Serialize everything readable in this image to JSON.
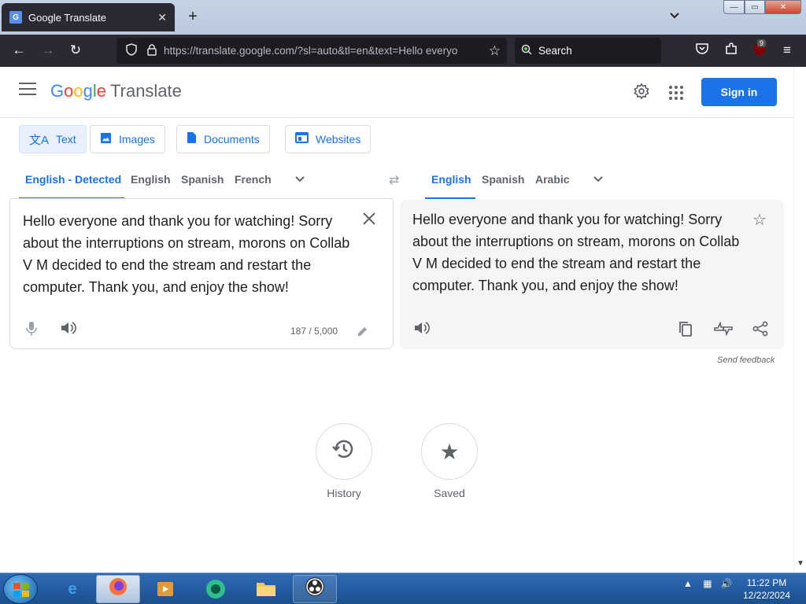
{
  "browser": {
    "tab_title": "Google Translate",
    "tab_close": "✕",
    "new_tab": "+",
    "tab_list": "⌄",
    "url": "https://translate.google.com/?sl=auto&tl=en&text=Hello everyo",
    "search_placeholder": "Search",
    "extension_badge": "9",
    "window_buttons": {
      "minimize": "—",
      "maximize": "▭",
      "close": "✕"
    }
  },
  "header": {
    "logo_letters": [
      "G",
      "o",
      "o",
      "g",
      "l",
      "e"
    ],
    "product_name": "Translate",
    "sign_in": "Sign in"
  },
  "modes": [
    {
      "label": "Text",
      "icon": "translate-icon",
      "active": true
    },
    {
      "label": "Images",
      "icon": "image-icon",
      "active": false
    },
    {
      "label": "Documents",
      "icon": "document-icon",
      "active": false
    },
    {
      "label": "Websites",
      "icon": "website-icon",
      "active": false
    }
  ],
  "source_langs": [
    "English - Detected",
    "English",
    "Spanish",
    "French"
  ],
  "target_langs": [
    "English",
    "Spanish",
    "Arabic"
  ],
  "source": {
    "text": "Hello everyone and thank you for watching! Sorry about the interruptions on stream, morons on Collab V M decided to end the stream and restart the computer. Thank you, and enjoy the show!",
    "char_count": "187 / 5,000"
  },
  "target": {
    "text": "Hello everyone and thank you for watching! Sorry about the interruptions on stream, morons on Collab V M decided to end the stream and restart the computer. Thank you, and enjoy the show!"
  },
  "send_feedback": "Send feedback",
  "history_label": "History",
  "saved_label": "Saved",
  "taskbar": {
    "time": "11:22 PM",
    "date": "12/22/2024"
  },
  "colors": {
    "accent": "#1a73e8",
    "browser_dark": "#2b2a33",
    "taskbar": "#1b4f8d"
  }
}
